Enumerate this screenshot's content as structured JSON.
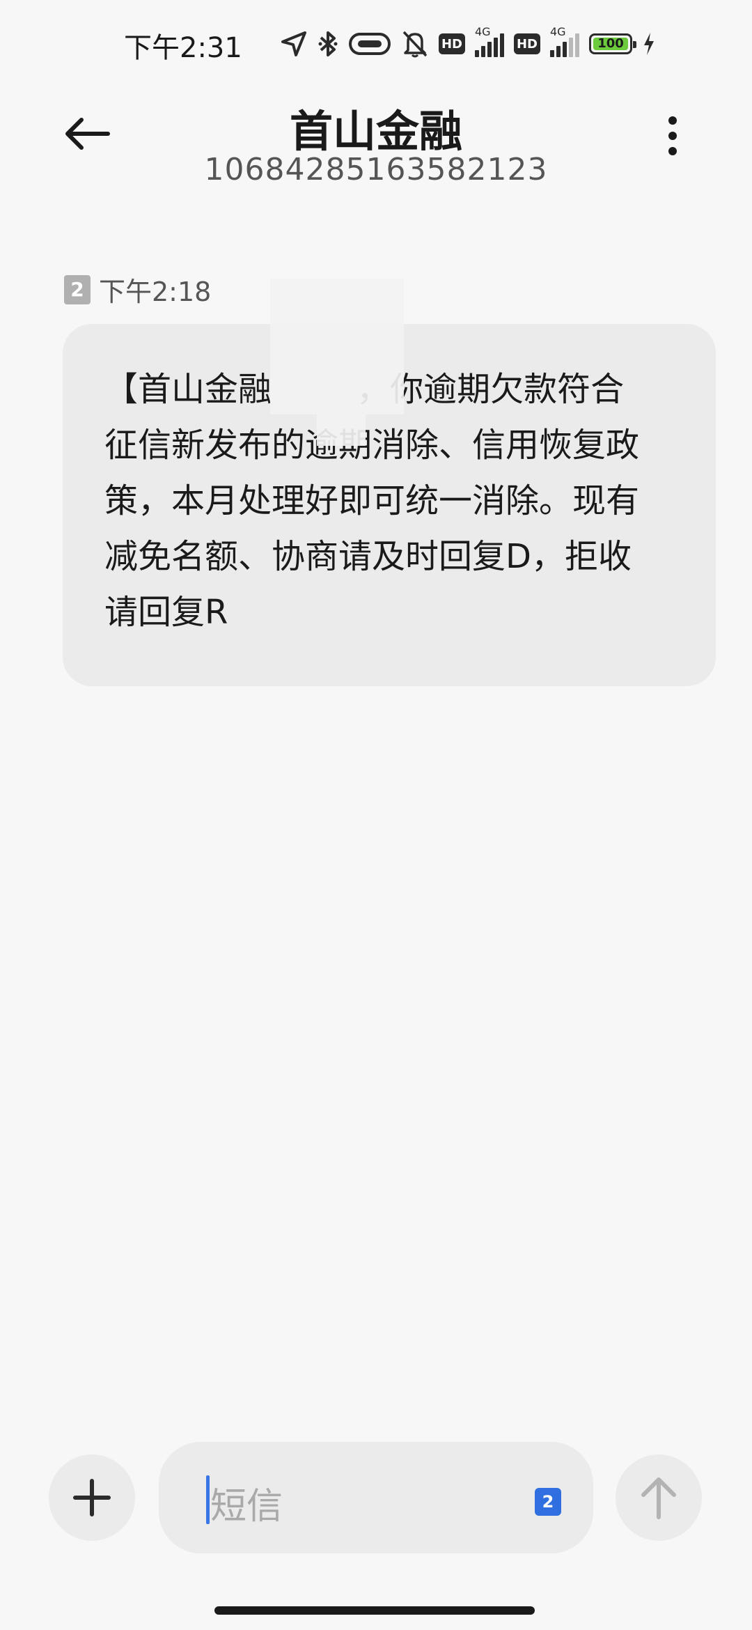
{
  "status_bar": {
    "time": "下午2:31",
    "battery": "100",
    "network_1": "4G",
    "network_2": "4G",
    "hd_label": "HD",
    "icons": [
      "location-icon",
      "bluetooth-icon",
      "nfc-icon",
      "mute-icon",
      "hd-icon",
      "signal-icon",
      "hd-icon",
      "signal-icon",
      "battery-icon",
      "charging-icon"
    ]
  },
  "header": {
    "title": "首山金融",
    "number": "10684285163582123",
    "back_icon": "back-arrow-icon",
    "menu_icon": "more-vert-icon"
  },
  "message": {
    "sim": "2",
    "time": "下午2:18",
    "text": "【首山金融        ，你逾期欠款符合\n征信新发布的逾期消除、信用恢复政\n策，本月处理好即可统一消除。现有\n减免名额、协商请及时回复D，拒收\n请回复R"
  },
  "composer": {
    "placeholder": "短信",
    "sim": "2",
    "add_icon": "plus-icon",
    "send_icon": "send-arrow-icon"
  },
  "colors": {
    "background": "#f7f7f7",
    "bubble": "#ebebeb",
    "accent": "#2f6fe0",
    "battery": "#6ccb3c"
  }
}
